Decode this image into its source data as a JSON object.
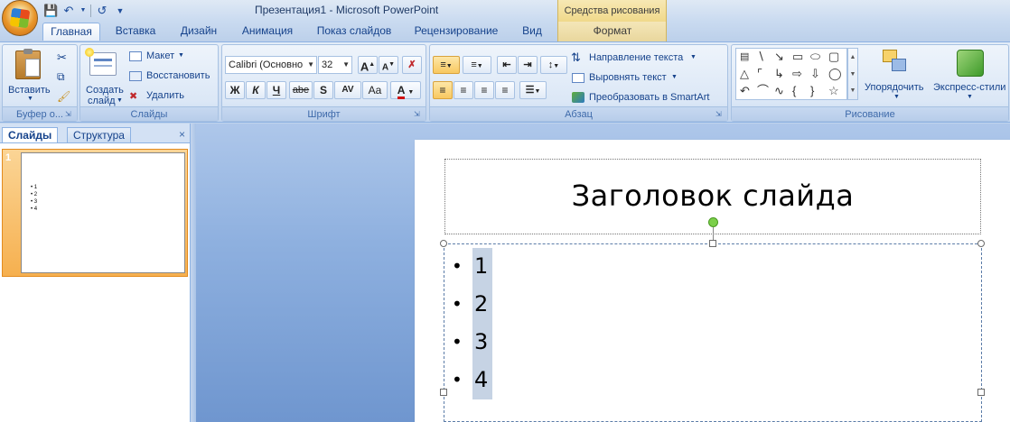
{
  "window": {
    "title": "Презентация1 - Microsoft PowerPoint",
    "context_group": "Средства рисования"
  },
  "quick_access": [
    "save-icon",
    "undo-icon",
    "redo-icon",
    "customize-icon"
  ],
  "tabs": [
    "Главная",
    "Вставка",
    "Дизайн",
    "Анимация",
    "Показ слайдов",
    "Рецензирование",
    "Вид",
    "Формат"
  ],
  "active_tab": "Главная",
  "ribbon": {
    "clipboard": {
      "paste": "Вставить",
      "label": "Буфер о..."
    },
    "slides": {
      "new_slide_line1": "Создать",
      "new_slide_line2": "слайд",
      "layout": "Макет",
      "reset": "Восстановить",
      "delete": "Удалить",
      "label": "Слайды"
    },
    "font": {
      "font_name": "Calibri (Основно",
      "font_size": "32",
      "grow": "A",
      "shrink": "A",
      "bold": "Ж",
      "italic": "К",
      "underline": "Ч",
      "strike": "abe",
      "shadow": "S",
      "spacing": "AV",
      "case": "Aa",
      "color": "A",
      "label": "Шрифт"
    },
    "paragraph": {
      "text_direction": "Направление текста",
      "align_text": "Выровнять текст",
      "smartart": "Преобразовать в SmartArt",
      "label": "Абзац"
    },
    "drawing": {
      "arrange": "Упорядочить",
      "quick_styles": "Экспресс-стили",
      "label": "Рисование"
    }
  },
  "pane": {
    "tab_slides": "Слайды",
    "tab_outline": "Структура",
    "close": "×",
    "slide_number": "1",
    "thumb_bullets": [
      "1",
      "2",
      "3",
      "4"
    ]
  },
  "slide": {
    "title": "Заголовок слайда",
    "bullets": [
      "1",
      "2",
      "3",
      "4"
    ]
  },
  "colors": {
    "accent_orange": "#f6b04f",
    "ribbon_blue": "#15428b",
    "workspace": "#8eb0df",
    "selection": "#c6d3e4",
    "rotate_handle": "#7bcf4a"
  }
}
